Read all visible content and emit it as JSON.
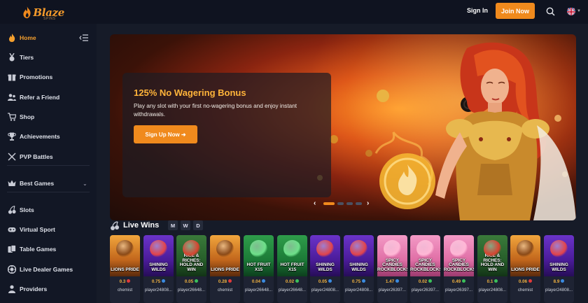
{
  "header": {
    "logo_text": "Blaze",
    "logo_sub": "SPINS",
    "signin_label": "Sign In",
    "join_label": "Join Now"
  },
  "sidebar": {
    "items": [
      {
        "label": "Home",
        "icon": "flame-icon"
      },
      {
        "label": "Tiers",
        "icon": "medal-icon"
      },
      {
        "label": "Promotions",
        "icon": "gift-icon"
      },
      {
        "label": "Refer a Friend",
        "icon": "users-icon"
      },
      {
        "label": "Shop",
        "icon": "cart-icon"
      },
      {
        "label": "Achievements",
        "icon": "trophy-icon"
      },
      {
        "label": "PVP Battles",
        "icon": "swords-icon"
      },
      {
        "label": "Best Games",
        "icon": "crown-icon"
      },
      {
        "label": "Slots",
        "icon": "cherries-icon"
      },
      {
        "label": "Virtual Sport",
        "icon": "gamepad-icon"
      },
      {
        "label": "Table Games",
        "icon": "cards-icon"
      },
      {
        "label": "Live Dealer Games",
        "icon": "chip-icon"
      },
      {
        "label": "Providers",
        "icon": "person-icon"
      }
    ]
  },
  "hero": {
    "title": "125% No Wagering Bonus",
    "description": "Play any slot with your first no-wagering bonus and enjoy instant withdrawals.",
    "cta_label": "Sign Up Now ➜",
    "slides_total": 4,
    "slide_active": 1
  },
  "live_wins": {
    "title": "Live Wins",
    "filters": [
      "M",
      "W",
      "D"
    ],
    "items": [
      {
        "game": "LIONS PRIDE",
        "amount": "0.3",
        "currency": "red",
        "player": "chemist",
        "theme": "lion"
      },
      {
        "game": "SHINING WILDS",
        "amount": "0.75",
        "currency": "blue",
        "player": "player24808...",
        "theme": "purple"
      },
      {
        "game": "RICE & RICHES: HOLD AND WIN",
        "amount": "0.05",
        "currency": "green",
        "player": "player26648...",
        "theme": "rice"
      },
      {
        "game": "LIONS PRIDE",
        "amount": "0.28",
        "currency": "red",
        "player": "chemist",
        "theme": "lion"
      },
      {
        "game": "HOT FRUIT X15",
        "amount": "0.04",
        "currency": "blue",
        "player": "player26648...",
        "theme": "green"
      },
      {
        "game": "HOT FRUIT X15",
        "amount": "0.02",
        "currency": "green",
        "player": "player26648...",
        "theme": "green"
      },
      {
        "game": "SHINING WILDS",
        "amount": "0.05",
        "currency": "blue",
        "player": "player24808...",
        "theme": "purple"
      },
      {
        "game": "SHINING WILDS",
        "amount": "0.75",
        "currency": "blue",
        "player": "player24808...",
        "theme": "purple"
      },
      {
        "game": "SPICY CANDIES ROCKBLOCKS",
        "amount": "1.47",
        "currency": "blue",
        "player": "player26397...",
        "theme": "candy"
      },
      {
        "game": "SPICY CANDIES ROCKBLOCKS",
        "amount": "0.02",
        "currency": "green",
        "player": "player26397...",
        "theme": "candy"
      },
      {
        "game": "SPICY CANDIES ROCKBLOCKS",
        "amount": "0.49",
        "currency": "green",
        "player": "player26397...",
        "theme": "candy"
      },
      {
        "game": "RICE & RICHES: HOLD AND WIN",
        "amount": "0.1",
        "currency": "green",
        "player": "player24808...",
        "theme": "rice"
      },
      {
        "game": "LIONS PRIDE",
        "amount": "0.06",
        "currency": "red",
        "player": "chemist",
        "theme": "lion"
      },
      {
        "game": "SHINING WILDS",
        "amount": "8.9",
        "currency": "blue",
        "player": "player24808...",
        "theme": "purple"
      }
    ]
  },
  "colors": {
    "accent": "#f08a1d",
    "bonus_title": "#ffb43a",
    "bg": "#0f1320",
    "sidebar": "#121725"
  }
}
